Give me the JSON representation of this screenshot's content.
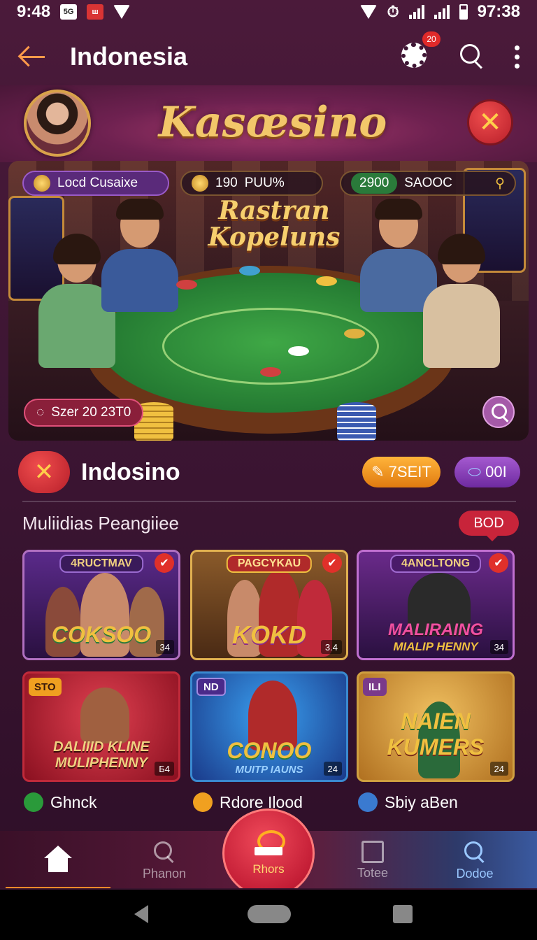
{
  "status_bar": {
    "time_left": "9:48",
    "badge_1": "5G",
    "badge_2": "ш",
    "time_right": "97:38"
  },
  "app_bar": {
    "title": "Indonesia",
    "notification_count": "20"
  },
  "hero": {
    "brand": "Kasœsino"
  },
  "scene": {
    "title_line1": "Rastran",
    "title_line2": "Kopeluns",
    "pill_left": "Locd Cusaixe",
    "pill_mid_value": "190",
    "pill_mid_label": "PUU%",
    "pill_right_value": "2900",
    "pill_right_label": "SAOOC",
    "date_tag": "Szer 20 23T0"
  },
  "section": {
    "title": "Indosino",
    "chip_orange": "7SEIT",
    "chip_violet": "00I",
    "subtitle": "Muliidias Peangiiee",
    "bod_button": "BOD"
  },
  "games": [
    {
      "tag": "4RUCTMAV",
      "name": "COKSOO",
      "count": "34"
    },
    {
      "tag": "PAGCYKAU",
      "name": "KOKD",
      "count": "3.4"
    },
    {
      "tag": "4ANCLTONG",
      "name_line1": "MALIRAING",
      "name_line2": "MIALIP HENNY",
      "count": "34"
    },
    {
      "tag": "STO",
      "name_line1": "DALIIID KLINE",
      "name_line2": "MULIPHENNY",
      "count": "Б4"
    },
    {
      "tag": "ND",
      "name_line1": "CONOO",
      "name_line2": "MUITP IAUNS",
      "count": "24"
    },
    {
      "tag": "ILI",
      "name_line1": "NAIEN",
      "name_line2": "KUMERS",
      "count": "24"
    }
  ],
  "bottom_labels": [
    "Ghnck",
    "Rdore Ilood",
    "Sbiy aBen"
  ],
  "nav": {
    "item_2": "Phanon",
    "center": "Rhors",
    "item_4": "Totee",
    "item_5": "Dodoe"
  },
  "colors": {
    "background": "#3e1634",
    "accent_orange": "#ff8a2a",
    "accent_red": "#c41e36",
    "gold": "#f2c76a"
  }
}
